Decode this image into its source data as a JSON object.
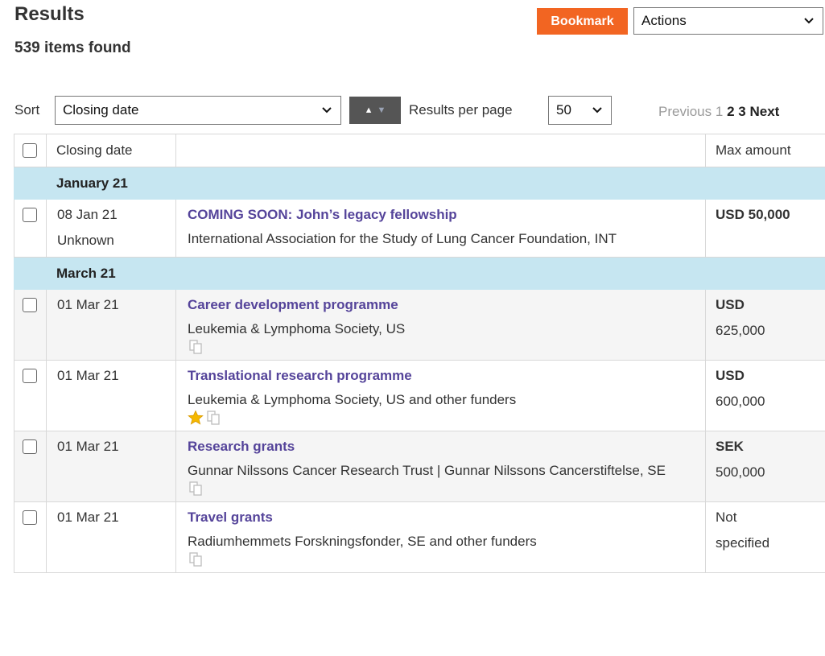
{
  "header": {
    "title": "Results",
    "count": "539 items found",
    "bookmark_label": "Bookmark",
    "actions_selected": "Actions"
  },
  "controls": {
    "sort_label": "Sort",
    "sort_selected": "Closing date",
    "rpp_label": "Results per page",
    "rpp_selected": "50"
  },
  "pager": {
    "previous": "Previous",
    "pages": [
      "1",
      "2",
      "3"
    ],
    "next": "Next"
  },
  "table": {
    "headers": {
      "date": "Closing date",
      "desc": "",
      "amount": "Max amount"
    },
    "groups": [
      {
        "label": "January 21",
        "rows": [
          {
            "date": "08 Jan 21",
            "date2": "Unknown",
            "title": "COMING SOON: John’s legacy fellowship",
            "funder": "International Association for the Study of Lung Cancer Foundation, INT",
            "amount_currency": "USD 50,000",
            "amount_value": "",
            "icons": []
          }
        ]
      },
      {
        "label": "March 21",
        "rows": [
          {
            "date": "01 Mar 21",
            "date2": "",
            "title": "Career development programme",
            "funder": "Leukemia & Lymphoma Society, US",
            "amount_currency": "USD",
            "amount_value": "625,000",
            "icons": [
              "duplicate-icon"
            ]
          },
          {
            "date": "01 Mar 21",
            "date2": "",
            "title": "Translational research programme",
            "funder": "Leukemia & Lymphoma Society, US and other funders",
            "amount_currency": "USD",
            "amount_value": "600,000",
            "icons": [
              "star-icon",
              "duplicate-icon"
            ]
          },
          {
            "date": "01 Mar 21",
            "date2": "",
            "title": "Research grants",
            "funder": "Gunnar Nilssons Cancer Research Trust | Gunnar Nilssons Cancerstiftelse, SE",
            "amount_currency": "SEK",
            "amount_value": "500,000",
            "icons": [
              "duplicate-icon"
            ]
          },
          {
            "date": "01 Mar 21",
            "date2": "",
            "title": "Travel grants",
            "funder": "Radiumhemmets Forskningsfonder, SE and other funders",
            "amount_currency": "Not",
            "amount_value": "specified",
            "amount_plain": true,
            "icons": [
              "duplicate-icon"
            ]
          }
        ]
      }
    ]
  },
  "colors": {
    "accent": "#f26522",
    "group_bg": "#c6e6f1",
    "link": "#55449a",
    "star": "#f5b800"
  }
}
